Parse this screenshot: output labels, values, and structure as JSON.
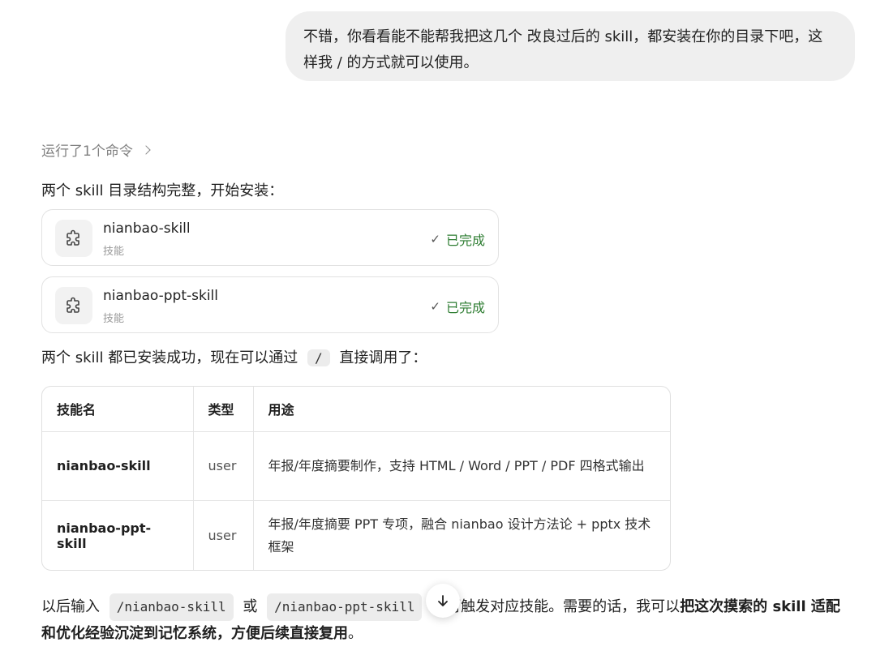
{
  "user_message": "不错，你看看能不能帮我把这几个 改良过后的 skill，都安装在你的目录下吧，这样我 / 的方式就可以使用。",
  "ran_commands_label": "运行了1个命令",
  "intro_text": "两个 skill 目录结构完整，开始安装：",
  "skills": [
    {
      "name": "nianbao-skill",
      "type": "技能",
      "status": "已完成",
      "icon": "puzzle-icon"
    },
    {
      "name": "nianbao-ppt-skill",
      "type": "技能",
      "status": "已完成",
      "icon": "puzzle-icon"
    }
  ],
  "install_done": {
    "before": "两个 skill 都已安装成功，现在可以通过",
    "code": "/",
    "after": "直接调用了："
  },
  "table": {
    "headers": [
      "技能名",
      "类型",
      "用途"
    ],
    "rows": [
      [
        "nianbao-skill",
        "user",
        "年报/年度摘要制作，支持 HTML / Word / PPT / PDF 四格式输出"
      ],
      [
        "nianbao-ppt-skill",
        "user",
        "年报/年度摘要 PPT 专项，融合 nianbao 设计方法论 + pptx 技术框架"
      ]
    ]
  },
  "footer": {
    "t1": "以后输入",
    "code1": "/nianbao-skill",
    "t2": "或",
    "code2": "/nianbao-ppt-skill",
    "t3": "即可触发对应技能。需要的话，我可以",
    "bold": "把这次摸索的 skill 适配和优化经验沉淀到记忆系统，方便后续直接复用",
    "t4": "。"
  },
  "scroll_button_icon": "arrow-down-icon"
}
